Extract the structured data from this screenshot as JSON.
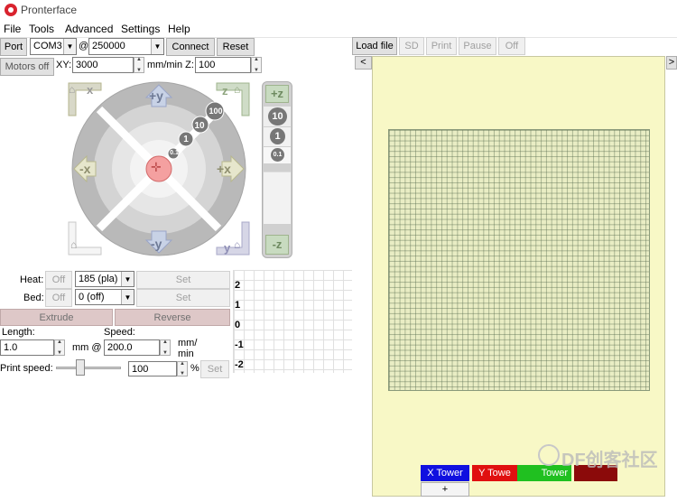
{
  "window": {
    "title": "Pronterface"
  },
  "menu": [
    "File",
    "Tools",
    "Advanced",
    "Settings",
    "Help"
  ],
  "connection": {
    "port_label": "Port",
    "port_value": "COM3",
    "at": "@",
    "baud_value": "250000",
    "connect_label": "Connect",
    "reset_label": "Reset"
  },
  "motion": {
    "motors_off_label": "Motors off",
    "xy_label": "XY:",
    "xy_value": "3000",
    "unit_label": "mm/min Z:",
    "z_value": "100"
  },
  "jog": {
    "labels": [
      "+y",
      "-y",
      "-x",
      "+x",
      "+z",
      "-z",
      "x",
      "y",
      "z"
    ],
    "steps": [
      "100",
      "10",
      "1",
      "0.1"
    ],
    "z_steps": [
      "10",
      "1",
      "0.1"
    ]
  },
  "temps": {
    "heat_label": "Heat:",
    "heat_off": "Off",
    "heat_value": "185 (pla)",
    "heat_set": "Set",
    "bed_label": "Bed:",
    "bed_off": "Off",
    "bed_value": "0 (off)",
    "bed_set": "Set"
  },
  "extrude": {
    "extrude_label": "Extrude",
    "reverse_label": "Reverse",
    "length_label": "Length:",
    "length_value": "1.0",
    "mm_at": "mm @",
    "speed_label": "Speed:",
    "speed_value": "200.0",
    "speed_unit_1": "mm/",
    "speed_unit_2": "min"
  },
  "print_speed": {
    "label": "Print speed:",
    "value": "100",
    "unit": "%",
    "set_label": "Set",
    "level": 0.35
  },
  "graph": {
    "ticks": [
      "2",
      "1",
      "0",
      "-1",
      "-2"
    ]
  },
  "file_controls": {
    "load_label": "Load file",
    "sd_label": "SD",
    "print_label": "Print",
    "pause_label": "Pause",
    "off_label": "Off",
    "nav_left": "<",
    "nav_right": ">"
  },
  "legend": {
    "x_tower": "X Tower",
    "y_tower": "Y Towe",
    "z_tower": "Tower",
    "plus": "+",
    "colors": {
      "x": "#1010e0",
      "y": "#e01010",
      "z": "#20c020",
      "bed": "#8b0a0a"
    }
  },
  "watermark": "DF创客社区"
}
